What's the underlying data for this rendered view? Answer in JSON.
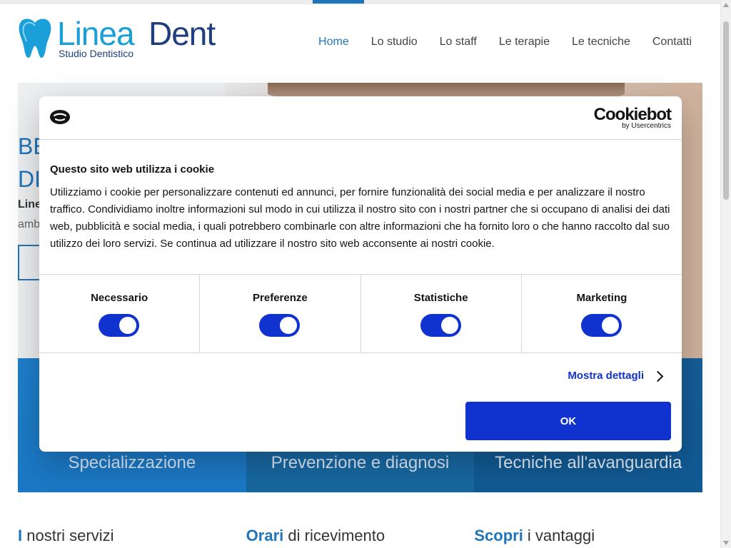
{
  "site": {
    "logo": {
      "brand_part1": "Linea",
      "brand_part2": "Dent",
      "tagline": "Studio Dentistico"
    },
    "nav": [
      {
        "label": "Home",
        "active": true
      },
      {
        "label": "Lo studio",
        "active": false
      },
      {
        "label": "Lo staff",
        "active": false
      },
      {
        "label": "Le terapie",
        "active": false
      },
      {
        "label": "Le tecniche",
        "active": false
      },
      {
        "label": "Contatti",
        "active": false
      }
    ],
    "hero": {
      "title_line1": "BE",
      "title_line2": "DI",
      "bold": "Line",
      "text": "amb"
    },
    "features": [
      {
        "label": "Specializzazione"
      },
      {
        "label": "Prevenzione e diagnosi"
      },
      {
        "label": "Tecniche all'avanguardia"
      }
    ],
    "bottom": [
      {
        "accent": "I",
        "rest": " nostri servizi"
      },
      {
        "accent": "Orari",
        "rest": " di ricevimento"
      },
      {
        "accent": "Scopri",
        "rest": " i vantaggi"
      }
    ],
    "colors": {
      "brand_blue": "#1f75bb",
      "logo_cyan": "#1b9fd9",
      "logo_navy": "#1f3f7e"
    }
  },
  "cookie_dialog": {
    "brand": {
      "name": "Cookiebot",
      "byline": "by Usercentrics"
    },
    "title": "Questo sito web utilizza i cookie",
    "body": "Utilizziamo i cookie per personalizzare contenuti ed annunci, per fornire funzionalità dei social media e per analizzare il nostro traffico. Condividiamo inoltre informazioni sul modo in cui utilizza il nostro sito con i nostri partner che si occupano di analisi dei dati web, pubblicità e social media, i quali potrebbero combinarle con altre informazioni che ha fornito loro o che hanno raccolto dal suo utilizzo dei loro servizi. Se continua ad utilizzare il nostro sito web acconsente ai nostri cookie.",
    "toggles": [
      {
        "label": "Necessario",
        "on": true
      },
      {
        "label": "Preferenze",
        "on": true
      },
      {
        "label": "Statistiche",
        "on": true
      },
      {
        "label": "Marketing",
        "on": true
      }
    ],
    "details_label": "Mostra dettagli",
    "ok_label": "OK",
    "colors": {
      "primary": "#1032cf"
    }
  }
}
